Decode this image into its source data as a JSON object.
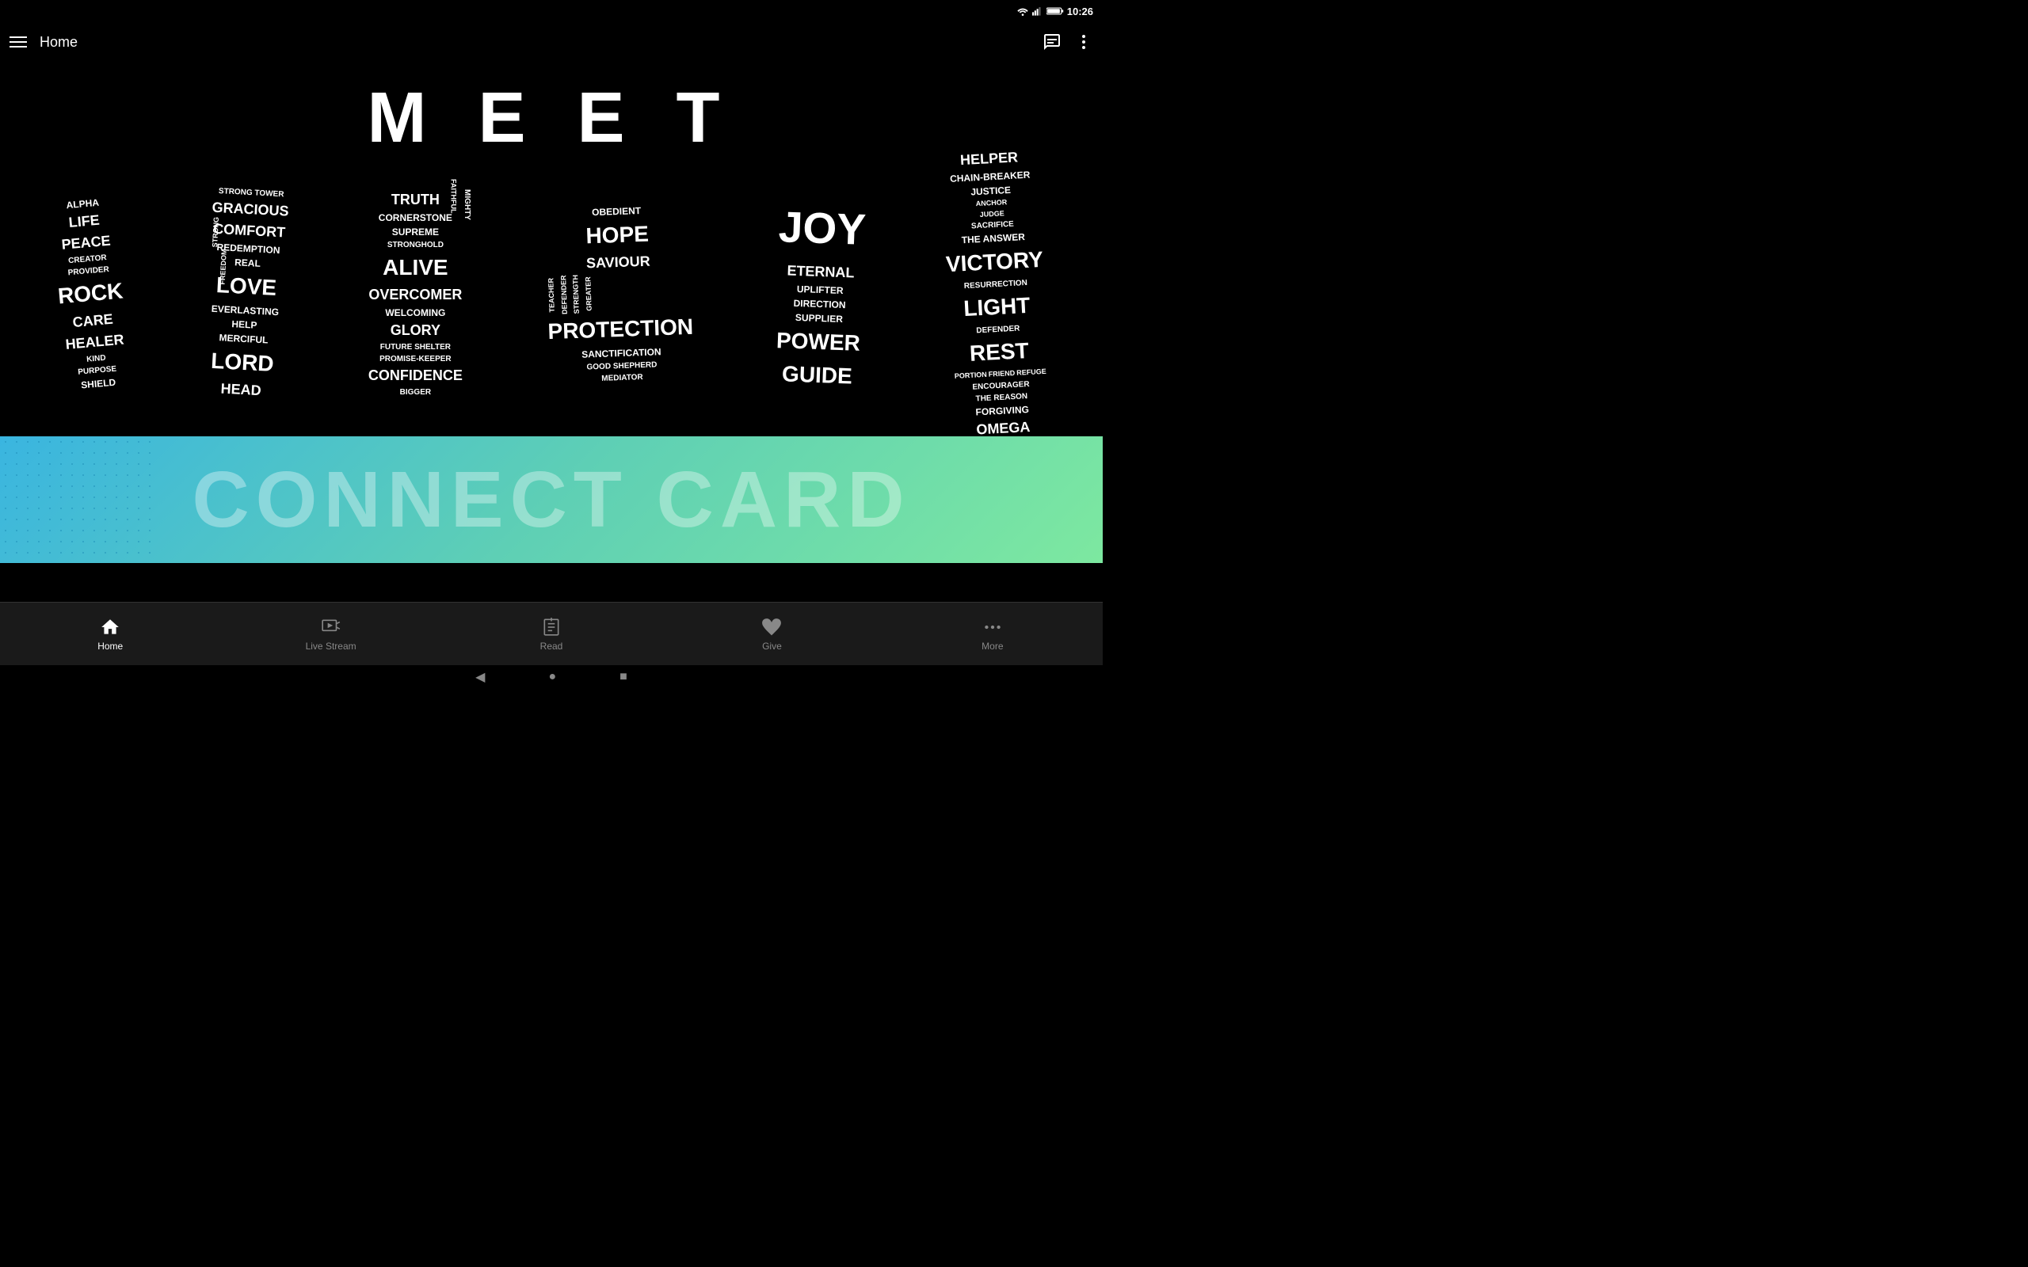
{
  "statusBar": {
    "time": "10:26"
  },
  "appBar": {
    "title": "Home",
    "menuIcon": "hamburger-icon",
    "chatIcon": "chat-icon",
    "moreIcon": "more-vertical-icon"
  },
  "meetSection": {
    "title": "M E E T"
  },
  "wordColumns": [
    {
      "id": "col1",
      "words": [
        "ALPHA",
        "LIFE",
        "PEACE",
        "CREATOR",
        "PROVIDER",
        "ROCK",
        "CARE",
        "HEALER",
        "KIND",
        "PURPOSE",
        "SHIELD"
      ]
    },
    {
      "id": "col2",
      "words": [
        "STRONG TOWER",
        "GRACIOUS",
        "COMFORT",
        "REDEMPTION",
        "REAL",
        "LOVE",
        "EVERLASTING",
        "HELP",
        "FREEDOM",
        "MERCIFUL",
        "LORD",
        "HEAD",
        "STRONG"
      ]
    },
    {
      "id": "col3",
      "words": [
        "TRUTH",
        "CORNERSTONE",
        "SUPREME",
        "FAITHFUL",
        "MIGHTY",
        "STRONGHOLD",
        "ALIVE",
        "OVERCOMER",
        "WELCOMING",
        "GLORY",
        "FUTURE SHELTER",
        "PROMISE-KEEPER",
        "CONFIDENCE",
        "BIGGER"
      ]
    },
    {
      "id": "col4",
      "words": [
        "OBEDIENT",
        "HOPE",
        "SAVIOUR",
        "TEACHER",
        "DEFENDER",
        "STRENGTH",
        "GREATER",
        "PROTECTION",
        "SANCTIFICATION",
        "GOOD SHEPHERD",
        "MEDIATOR"
      ]
    },
    {
      "id": "col5",
      "words": [
        "JOY",
        "ETERNAL",
        "UPLIFTER",
        "DIRECTION",
        "SUPPLIER",
        "POWER",
        "GUIDE"
      ]
    },
    {
      "id": "col6",
      "words": [
        "HELPER",
        "CHAIN-BREAKER",
        "JUSTICE",
        "ANCHOR",
        "JUDGE",
        "SACRIFICE",
        "THE ANSWER",
        "VICTORY",
        "RESURRECTION",
        "LIGHT",
        "DEFENDER",
        "REST",
        "PORTION",
        "FRIEND",
        "REFUGE",
        "ENCOURAGER",
        "THE REASON",
        "FORGIVING",
        "OMEGA"
      ]
    }
  ],
  "connectSection": {
    "text": "CONNECT CARD"
  },
  "bottomNav": {
    "items": [
      {
        "id": "home",
        "label": "Home",
        "icon": "home-icon",
        "active": true
      },
      {
        "id": "live-stream",
        "label": "Live Stream",
        "icon": "live-stream-icon",
        "active": false
      },
      {
        "id": "read",
        "label": "Read",
        "icon": "read-icon",
        "active": false
      },
      {
        "id": "give",
        "label": "Give",
        "icon": "give-icon",
        "active": false
      },
      {
        "id": "more",
        "label": "More",
        "icon": "more-dots-icon",
        "active": false
      }
    ]
  },
  "androidNav": {
    "backLabel": "◀",
    "homeLabel": "●",
    "recentLabel": "■"
  }
}
